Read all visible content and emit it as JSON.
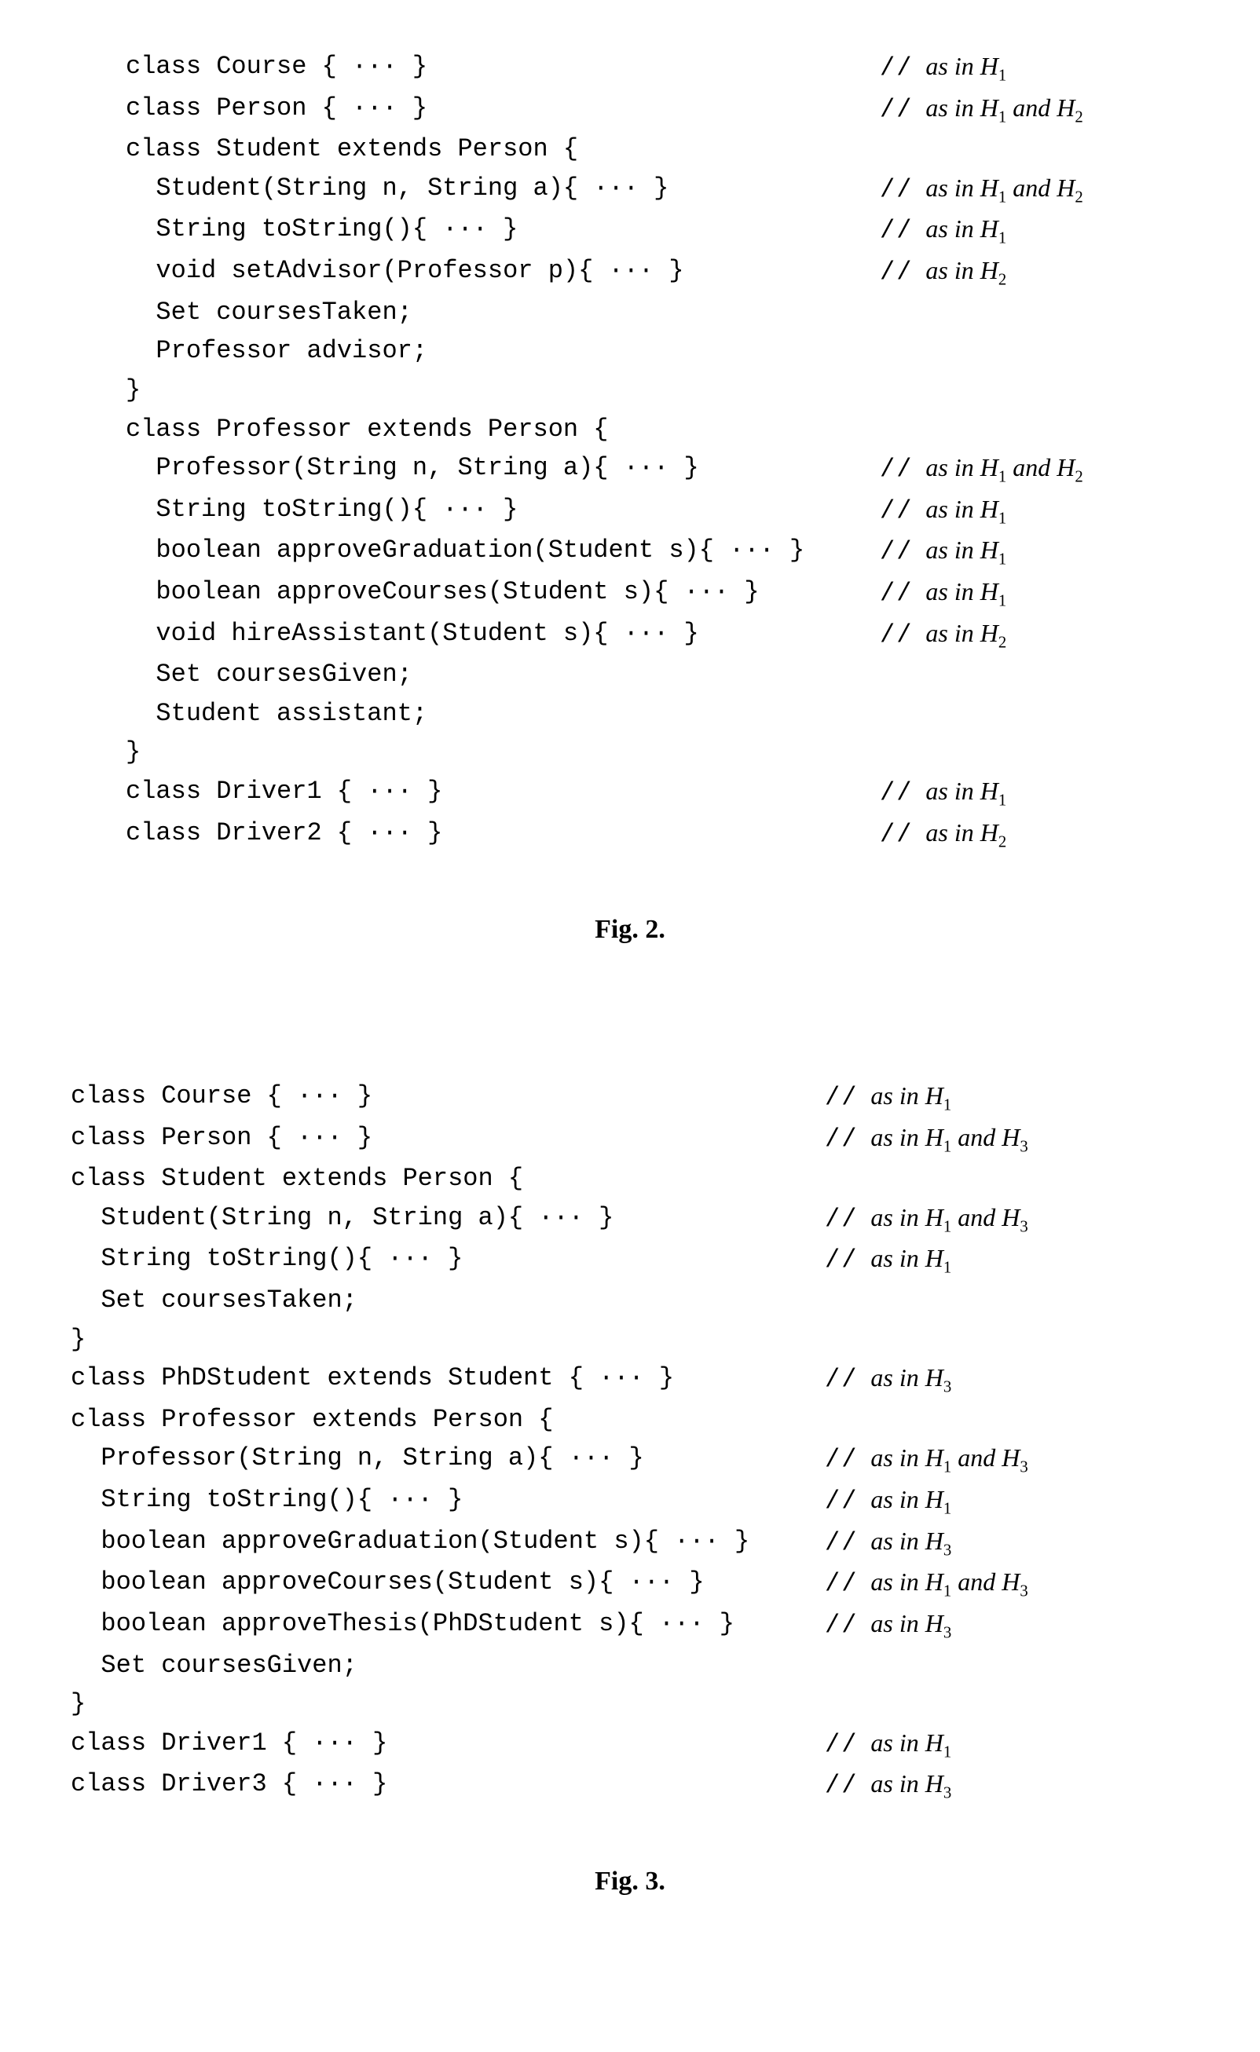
{
  "fig2": {
    "caption_label": "Fig. 2.",
    "lines": [
      {
        "indent": 0,
        "code": "class Course { ··· }",
        "comment_h": "H1"
      },
      {
        "indent": 0,
        "code": "class Person { ··· }",
        "comment_h": "H1_and_H2"
      },
      {
        "indent": 0,
        "code": "class Student extends Person {",
        "comment_h": ""
      },
      {
        "indent": 1,
        "code": "Student(String n, String a){ ··· }",
        "comment_h": "H1_and_H2"
      },
      {
        "indent": 1,
        "code": "String toString(){ ··· }",
        "comment_h": "H1"
      },
      {
        "indent": 1,
        "code": "void setAdvisor(Professor p){ ··· }",
        "comment_h": "H2"
      },
      {
        "indent": 1,
        "code": "Set coursesTaken;",
        "comment_h": ""
      },
      {
        "indent": 1,
        "code": "Professor advisor;",
        "comment_h": ""
      },
      {
        "indent": 0,
        "code": "}",
        "comment_h": ""
      },
      {
        "indent": 0,
        "code": "class Professor extends Person {",
        "comment_h": ""
      },
      {
        "indent": 1,
        "code": "Professor(String n, String a){ ··· }",
        "comment_h": "H1_and_H2"
      },
      {
        "indent": 1,
        "code": "String toString(){ ··· }",
        "comment_h": "H1"
      },
      {
        "indent": 1,
        "code": "boolean approveGraduation(Student s){ ··· }",
        "comment_h": "H1"
      },
      {
        "indent": 1,
        "code": "boolean approveCourses(Student s){ ··· }",
        "comment_h": "H1"
      },
      {
        "indent": 1,
        "code": "void hireAssistant(Student s){ ··· }",
        "comment_h": "H2"
      },
      {
        "indent": 1,
        "code": "Set coursesGiven;",
        "comment_h": ""
      },
      {
        "indent": 1,
        "code": "Student assistant;",
        "comment_h": ""
      },
      {
        "indent": 0,
        "code": "}",
        "comment_h": ""
      },
      {
        "indent": 0,
        "code": "class Driver1 { ··· }",
        "comment_h": "H1"
      },
      {
        "indent": 0,
        "code": "class Driver2 { ··· }",
        "comment_h": "H2"
      }
    ]
  },
  "fig3": {
    "caption_label": "Fig. 3.",
    "lines": [
      {
        "indent": 0,
        "code": "class Course { ··· }",
        "comment_h": "H1"
      },
      {
        "indent": 0,
        "code": "class Person { ··· }",
        "comment_h": "H1_and_H3"
      },
      {
        "indent": 0,
        "code": "class Student extends Person {",
        "comment_h": ""
      },
      {
        "indent": 1,
        "code": "Student(String n, String a){ ··· }",
        "comment_h": "H1_and_H3"
      },
      {
        "indent": 1,
        "code": "String toString(){ ··· }",
        "comment_h": "H1"
      },
      {
        "indent": 1,
        "code": "Set coursesTaken;",
        "comment_h": ""
      },
      {
        "indent": 0,
        "code": "}",
        "comment_h": ""
      },
      {
        "indent": 0,
        "code": "class PhDStudent extends Student { ··· }",
        "comment_h": "H3"
      },
      {
        "indent": 0,
        "code": "class Professor extends Person {",
        "comment_h": ""
      },
      {
        "indent": 1,
        "code": "Professor(String n, String a){ ··· }",
        "comment_h": "H1_and_H3"
      },
      {
        "indent": 1,
        "code": "String toString(){ ··· }",
        "comment_h": "H1"
      },
      {
        "indent": 1,
        "code": "boolean approveGraduation(Student s){ ··· }",
        "comment_h": "H3"
      },
      {
        "indent": 1,
        "code": "boolean approveCourses(Student s){ ··· }",
        "comment_h": "H1_and_H3"
      },
      {
        "indent": 1,
        "code": "boolean approveThesis(PhDStudent s){ ··· }",
        "comment_h": "H3"
      },
      {
        "indent": 1,
        "code": "Set coursesGiven;",
        "comment_h": ""
      },
      {
        "indent": 0,
        "code": "}",
        "comment_h": ""
      },
      {
        "indent": 0,
        "code": "class Driver1 { ··· }",
        "comment_h": "H1"
      },
      {
        "indent": 0,
        "code": "class Driver3 { ··· }",
        "comment_h": "H3"
      }
    ]
  },
  "comment_phrases": {
    "prefix": "as in",
    "and": "and"
  }
}
